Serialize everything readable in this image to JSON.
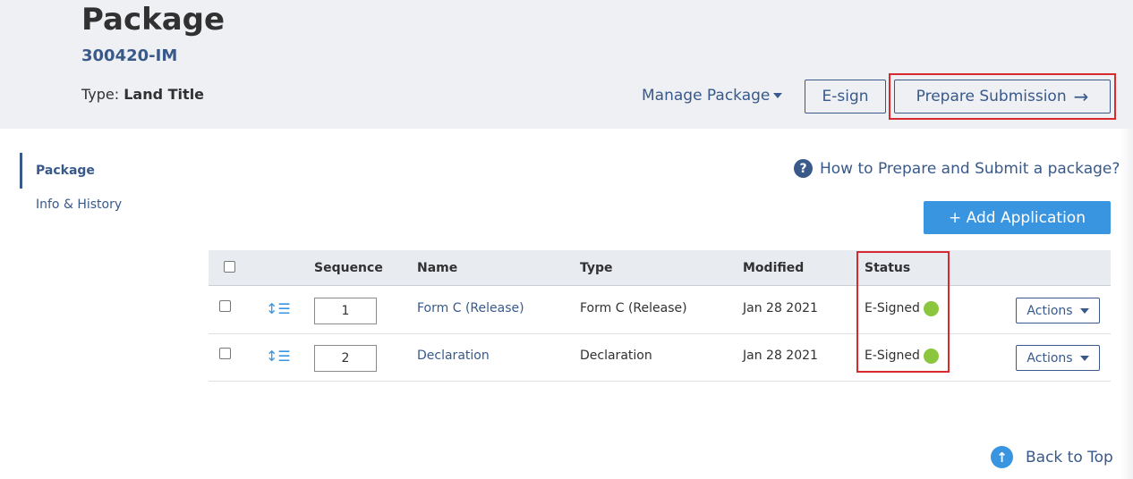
{
  "header": {
    "title": "Package",
    "package_id": "300420-IM",
    "type_label": "Type:",
    "type_value": "Land Title",
    "manage_label": "Manage Package",
    "esign_label": "E-sign",
    "prepare_label": "Prepare Submission",
    "prepare_icon": "arrow-right-icon"
  },
  "sidebar": {
    "items": [
      {
        "label": "Package",
        "active": true
      },
      {
        "label": "Info & History",
        "active": false
      }
    ]
  },
  "help": {
    "icon": "question-circle-icon",
    "label": "How to Prepare and Submit a package?"
  },
  "add_application_label": "+ Add Application",
  "table": {
    "columns": [
      "",
      "",
      "Sequence",
      "Name",
      "Type",
      "Modified",
      "Status",
      ""
    ],
    "rows": [
      {
        "sequence": "1",
        "name": "Form C (Release)",
        "type": "Form C (Release)",
        "modified": "Jan 28 2021",
        "status": "E-Signed",
        "status_color": "#8cc63f",
        "actions_label": "Actions"
      },
      {
        "sequence": "2",
        "name": "Declaration",
        "type": "Declaration",
        "modified": "Jan 28 2021",
        "status": "E-Signed",
        "status_color": "#8cc63f",
        "actions_label": "Actions"
      }
    ]
  },
  "back_to_top": {
    "icon": "arrow-up-circle-icon",
    "label": "Back to Top"
  },
  "colors": {
    "accent": "#38598a",
    "button_blue": "#3a95e0",
    "highlight": "#d8292f",
    "status_green": "#8cc63f"
  }
}
